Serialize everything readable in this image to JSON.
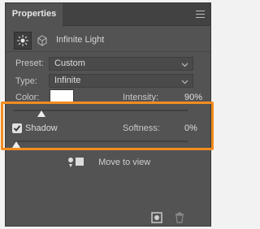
{
  "panel": {
    "tab_label": "Properties",
    "title": "Infinite Light"
  },
  "fields": {
    "preset_label": "Preset:",
    "preset_value": "Custom",
    "type_label": "Type:",
    "type_value": "Infinite",
    "color_label": "Color:",
    "color_value": "#ffffff",
    "intensity_label": "Intensity:",
    "intensity_value": "90%",
    "intensity_level": 0.0,
    "shadow_label": "Shadow",
    "shadow_checked": true,
    "softness_label": "Softness:",
    "softness_value": "0%",
    "softness_level": 0.0
  },
  "move_to_view_label": "Move to view",
  "icons": {
    "light": "sun-icon",
    "scene": "3d-scene-icon",
    "menu": "panel-menu-icon",
    "move": "move-to-view-icon",
    "render": "render-icon",
    "delete": "trash-icon"
  },
  "colors": {
    "highlight": "#f28c1f",
    "panel_bg": "#535353"
  }
}
